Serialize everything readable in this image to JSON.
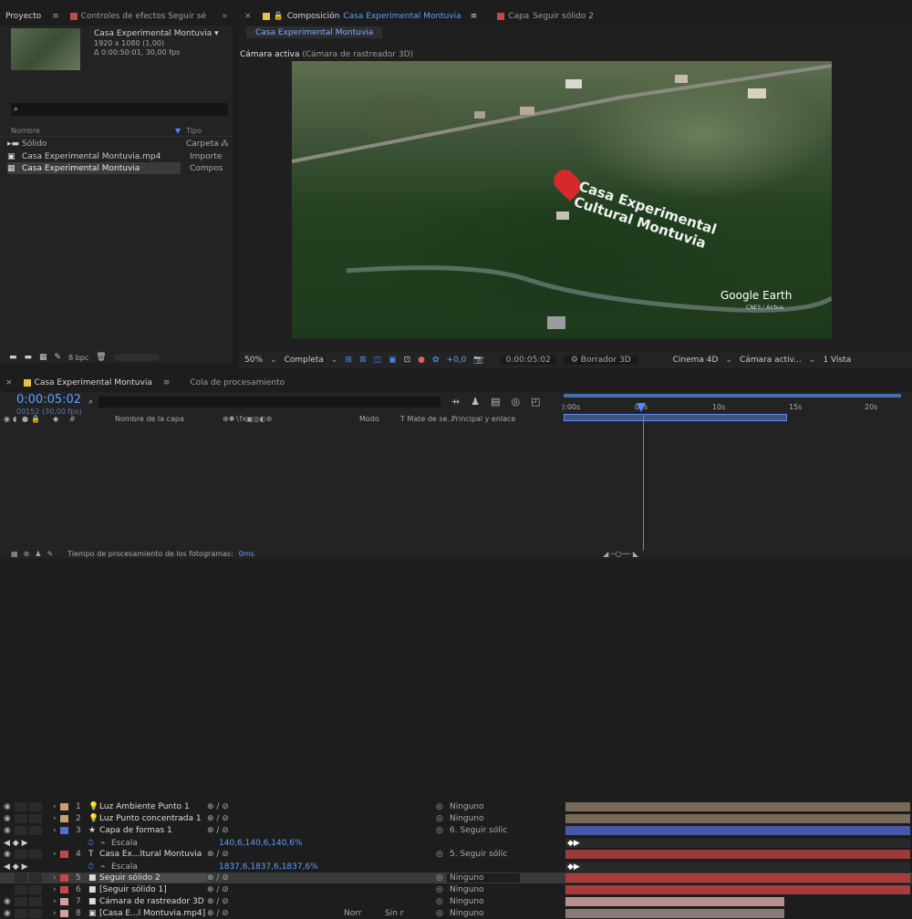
{
  "project_panel": {
    "tabs": [
      {
        "label": "Proyecto"
      },
      {
        "label": "≡"
      },
      {
        "label": "Controles de efectos Seguir sé"
      },
      {
        "label": "»"
      }
    ],
    "preview": {
      "name": "Casa Experimental Montuvia ▾",
      "line1": "1920 x 1080 (1,00)",
      "line2": "Δ 0:00:50:01, 30,00 fps"
    },
    "search_placeholder": "",
    "columns": {
      "name": "Nombre",
      "type": "Tipo"
    },
    "items": [
      {
        "name": "Sólido",
        "type": "Carpeta"
      },
      {
        "name": "Casa Experimental Montuvia.mp4",
        "type": "Importe"
      },
      {
        "name": "Casa Experimental Montuvia",
        "type": "Compos"
      }
    ],
    "bpc": "8 bpc"
  },
  "comp_panel": {
    "tabs": {
      "close": "×",
      "comp_label": "Composición",
      "comp_name": "Casa Experimental Montuvia",
      "menu": "≡",
      "layer_label": "Capa",
      "layer_name": "Seguir sólido 2"
    },
    "subtab": "Casa Experimental Montuvia",
    "camera_label": "Cámara activa",
    "camera_name": "(Cámara de rastreador 3D)",
    "overlay_title_1": "Casa Experimental",
    "overlay_title_2": "Cultural Montuvia",
    "google_earth": "Google Earth",
    "ge_sub": "CNES / Airbus",
    "footer": {
      "zoom": "50%",
      "quality": "Completa",
      "exposure": "+0,0",
      "timecode": "0:00:05:02",
      "renderer": "Borrador 3D",
      "engine": "Cinema 4D",
      "camera": "Cámara activ...",
      "views": "1 Vista"
    }
  },
  "timeline": {
    "tabs": [
      {
        "label": "Casa Experimental Montuvia"
      },
      {
        "label": "≡"
      },
      {
        "label": "Cola de procesamiento"
      }
    ],
    "timecode": "0:00:05:02",
    "frames": "00152 (30,00 fps)",
    "headers": {
      "num": "#",
      "name": "Nombre de la capa",
      "mode": "Modo",
      "track": "T  Mate de se...",
      "parent": "Principal y enlace"
    },
    "ruler": [
      "):00s",
      "05s",
      "10s",
      "15s",
      "20s"
    ],
    "layers": [
      {
        "num": "1",
        "icon": "💡",
        "name": "Luz Ambiente Punto 1",
        "parent": "Ninguno",
        "color": "#c8a070",
        "bar": "#7a6a5a"
      },
      {
        "num": "2",
        "icon": "💡",
        "name": "Luz Punto concentrada 1",
        "parent": "Ninguno",
        "color": "#c8a070",
        "bar": "#7a6a5a"
      },
      {
        "num": "3",
        "icon": "★",
        "name": "Capa de formas 1",
        "parent": "6. Seguir sólic",
        "color": "#4f6fd8",
        "bar": "#4858a8"
      },
      {
        "num": "",
        "icon": "",
        "name": "Escala",
        "values": "140,6,140,6,140,6%",
        "prop": true
      },
      {
        "num": "4",
        "icon": "T",
        "name": "Casa Ex...ltural Montuvia",
        "parent": "5. Seguir sólic",
        "color": "#c44848",
        "bar": "#9a3a3a"
      },
      {
        "num": "",
        "icon": "",
        "name": "Escala",
        "values": "1837,6,1837,6,1837,6%",
        "prop": true
      },
      {
        "num": "5",
        "icon": "■",
        "name": "Seguir sólido 2",
        "parent": "Ninguno",
        "color": "#c44848",
        "bar": "#a83c3c"
      },
      {
        "num": "6",
        "icon": "■",
        "name": "[Seguir sólido 1]",
        "parent": "Ninguno",
        "color": "#c44848",
        "bar": "#a83c3c"
      },
      {
        "num": "7",
        "icon": "■",
        "name": "Cámara de rastreador 3D",
        "parent": "Ninguno",
        "color": "#d0a0a0",
        "bar": "#b89090"
      },
      {
        "num": "8",
        "icon": "▣",
        "name": "[Casa E...l Montuvia.mp4]",
        "parent": "Ninguno",
        "color": "#d0a0a0",
        "bar": "#8a7a7a",
        "mode": "Norr",
        "track": "Sin r"
      }
    ],
    "status": "Tiempo de procesamiento de los fotogramas:",
    "status_val": "0ms"
  }
}
